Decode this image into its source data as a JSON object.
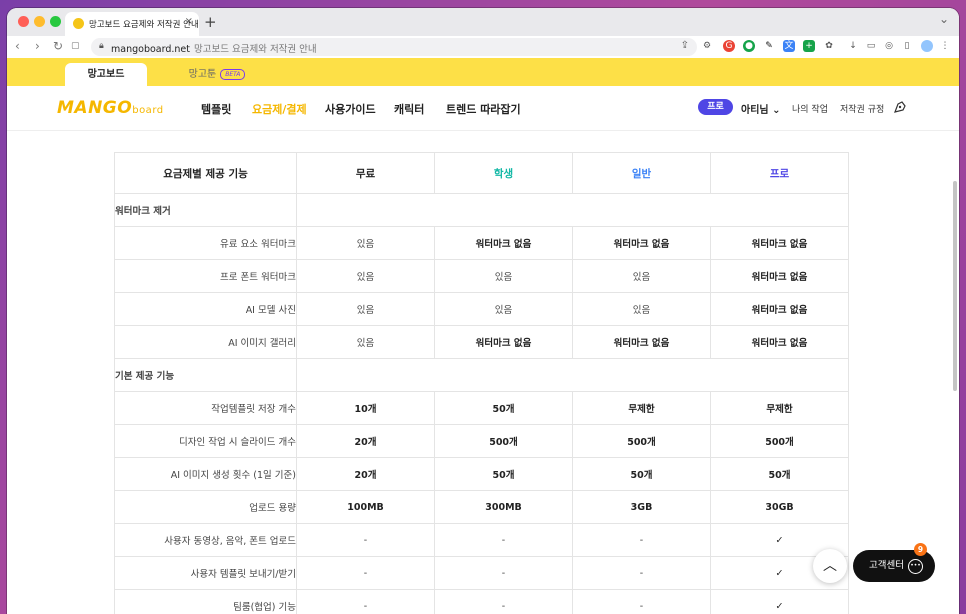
{
  "browser": {
    "tab_title": "망고보드 요금제와 저작권 안내",
    "new_tab": "+",
    "url_host": "mangoboard.net",
    "url_title": "망고보드 요금제와 저작권 안내"
  },
  "site_tabs": [
    {
      "label": "망고보드"
    },
    {
      "label": "망고툰",
      "badge": "BETA"
    }
  ],
  "header": {
    "logo_main": "MANGO",
    "logo_sub": "board",
    "nav": [
      {
        "label": "템플릿"
      },
      {
        "label": "요금제/결제"
      },
      {
        "label": "사용가이드"
      },
      {
        "label": "캐릭터"
      },
      {
        "label": "트렌드 따라잡기"
      }
    ],
    "pro_badge": "프로",
    "user": "아티님",
    "my_work": "나의 작업",
    "copyright": "저작권 규정"
  },
  "table": {
    "head": [
      "요금제별 제공 기능",
      "무료",
      "학생",
      "일반",
      "프로"
    ],
    "sections": [
      {
        "title": "워터마크 제거",
        "rows": [
          {
            "feature": "유료 요소 워터마크",
            "values": [
              "있음",
              "워터마크 없음",
              "워터마크 없음",
              "워터마크 없음"
            ]
          },
          {
            "feature": "프로 폰트 워터마크",
            "values": [
              "있음",
              "있음",
              "있음",
              "워터마크 없음"
            ]
          },
          {
            "feature": "AI 모델 사진",
            "values": [
              "있음",
              "있음",
              "있음",
              "워터마크 없음"
            ]
          },
          {
            "feature": "AI 이미지 갤러리",
            "values": [
              "있음",
              "워터마크 없음",
              "워터마크 없음",
              "워터마크 없음"
            ]
          }
        ]
      },
      {
        "title": "기본 제공 기능",
        "rows": [
          {
            "feature": "작업템플릿 저장 개수",
            "values": [
              "10개",
              "50개",
              "무제한",
              "무제한"
            ]
          },
          {
            "feature": "디자인 작업 시 슬라이드 개수",
            "values": [
              "20개",
              "500개",
              "500개",
              "500개"
            ]
          },
          {
            "feature": "AI 이미지 생성 횟수 (1일 기준)",
            "values": [
              "20개",
              "50개",
              "50개",
              "50개"
            ]
          },
          {
            "feature": "업로드 용량",
            "values": [
              "100MB",
              "300MB",
              "3GB",
              "30GB"
            ]
          },
          {
            "feature": "사용자 동영상, 음악, 폰트 업로드",
            "values": [
              "-",
              "-",
              "-",
              "✓"
            ]
          },
          {
            "feature": "사용자 템플릿 보내기/받기",
            "values": [
              "-",
              "-",
              "-",
              "✓"
            ]
          },
          {
            "feature": "팀룸(협업) 기능",
            "values": [
              "-",
              "-",
              "-",
              "✓"
            ]
          }
        ]
      }
    ]
  },
  "floating": {
    "top_button": "^",
    "cs_label": "고객센터",
    "cs_badge": "9"
  }
}
